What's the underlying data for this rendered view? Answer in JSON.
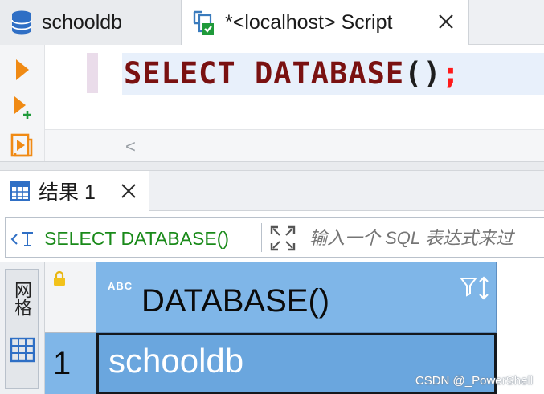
{
  "editor_tabs": [
    {
      "label": "schooldb",
      "icon": "database-icon",
      "active": false
    },
    {
      "label": "*<localhost> Script",
      "icon": "sql-script-icon",
      "active": true
    }
  ],
  "editor": {
    "sql_keyword_1": "SELECT",
    "sql_keyword_2": "DATABASE",
    "sql_parens": "()",
    "sql_semicolon": ";",
    "scroll_arrow": "<"
  },
  "toolbar_icons": [
    "execute-statement-icon",
    "execute-in-new-tab-icon",
    "execute-script-icon"
  ],
  "results": {
    "tab_label": "结果 1",
    "filter_query": "SELECT DATABASE()",
    "filter_placeholder": "输入一个 SQL 表达式来过",
    "side_tab_label": "网格",
    "column": {
      "type_badge": "ABC",
      "name": "DATABASE()"
    },
    "rows": [
      {
        "row_number": "1",
        "value": "schooldb"
      }
    ]
  },
  "watermark": "CSDN @_PowerShell",
  "colors": {
    "keyword": "#7a1111",
    "semicolon": "#ff1a1a",
    "header_blue": "#7fb6e8",
    "selected_cell": "#6aa6de",
    "filter_green": "#1a8a1a",
    "run_orange": "#f08a14"
  }
}
